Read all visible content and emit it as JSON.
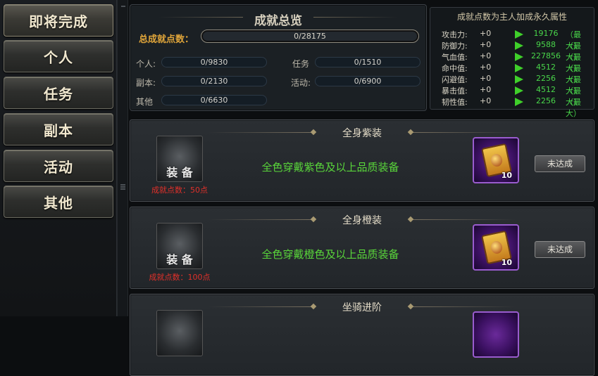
{
  "sidebar": {
    "items": [
      {
        "label": "即将完成"
      },
      {
        "label": "个人"
      },
      {
        "label": "任务"
      },
      {
        "label": "副本"
      },
      {
        "label": "活动"
      },
      {
        "label": "其他"
      }
    ]
  },
  "overview": {
    "title": "成就总览",
    "total_label": "总成就点数：",
    "total_value": "0/28175",
    "stats": {
      "personal": {
        "label": "个人:",
        "value": "0/9830"
      },
      "task": {
        "label": "任务",
        "value": "0/1510"
      },
      "dungeon": {
        "label": "副本:",
        "value": "0/2130"
      },
      "activity": {
        "label": "活动:",
        "value": "0/6900"
      },
      "other": {
        "label": "其他",
        "value": "0/6630"
      }
    }
  },
  "attributes": {
    "title": "成就点数为主人加成永久属性",
    "rows": [
      {
        "name": "攻击力:",
        "plus": "+0",
        "max_value": "19176",
        "max_tag": "（最大）"
      },
      {
        "name": "防御力:",
        "plus": "+0",
        "max_value": "9588",
        "max_tag": "（最大）"
      },
      {
        "name": "气血值:",
        "plus": "+0",
        "max_value": "227856",
        "max_tag": "（最大）"
      },
      {
        "name": "命中值:",
        "plus": "+0",
        "max_value": "4512",
        "max_tag": "（最大）"
      },
      {
        "name": "闪避值:",
        "plus": "+0",
        "max_value": "2256",
        "max_tag": "（最大）"
      },
      {
        "name": "暴击值:",
        "plus": "+0",
        "max_value": "4512",
        "max_tag": "（最大）"
      },
      {
        "name": "韧性值:",
        "plus": "+0",
        "max_value": "2256",
        "max_tag": "（最大）"
      }
    ],
    "arrow_color": "#3fcf2a"
  },
  "achievements": [
    {
      "title": "全身紫装",
      "badge_text": "装 备",
      "points": "成就点数：50点",
      "description": "全色穿戴紫色及以上品质装备",
      "reward_count": "10",
      "status": "未达成"
    },
    {
      "title": "全身橙装",
      "badge_text": "装 备",
      "points": "成就点数：100点",
      "description": "全色穿戴橙色及以上品质装备",
      "reward_count": "10",
      "status": "未达成"
    },
    {
      "title": "坐骑进阶"
    }
  ],
  "colors": {
    "accent_gold": "#e0a53a",
    "desc_green": "#59d63a",
    "points_red": "#e0302a",
    "max_green": "#49d64a"
  }
}
